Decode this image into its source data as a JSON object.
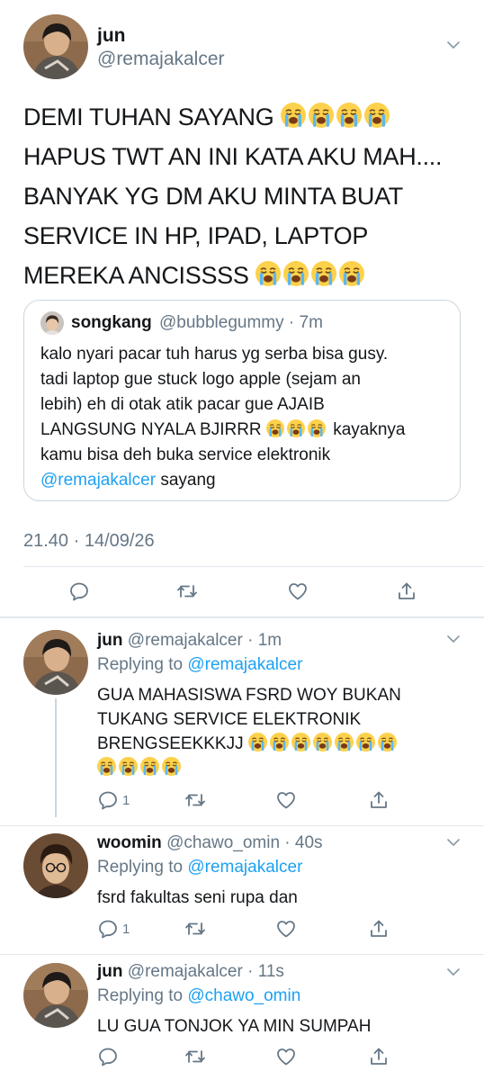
{
  "main_tweet": {
    "display_name": "jun",
    "handle": "@remajakalcer",
    "lines": [
      {
        "text": "DEMI TUHAN SAYANG",
        "emoji_count": 4
      },
      {
        "text": "HAPUS TWT AN INI KATA AKU MAH....",
        "emoji_count": 0
      },
      {
        "text": "BANYAK YG DM AKU MINTA BUAT",
        "emoji_count": 0
      },
      {
        "text": "SERVICE IN HP, IPAD, LAPTOP",
        "emoji_count": 0
      },
      {
        "text": "MEREKA ANCISSSS",
        "emoji_count": 4
      }
    ],
    "timestamp": "21.40 · 14/09/26"
  },
  "quote": {
    "display_name": "songkang",
    "meta": "@bubblegummy · 7m",
    "line1": "kalo nyari pacar tuh harus yg serba bisa gusy.",
    "line2": "tadi laptop gue stuck logo apple (sejam an",
    "line3": "lebih) eh di otak atik pacar gue AJAIB",
    "line4_before": "LANGSUNG NYALA BJIRRR",
    "line4_after": "kayaknya",
    "line5": "kamu bisa deh buka service elektronik",
    "mention": "@remajakalcer",
    "line6_after": " sayang"
  },
  "replies": [
    {
      "display_name": "jun",
      "meta": "@remajakalcer · 1m",
      "replying_prefix": "Replying to ",
      "replying_to": "@remajakalcer",
      "line1": "GUA MAHASISWA FSRD WOY BUKAN",
      "line2": "TUKANG SERVICE ELEKTRONIK",
      "line3": "BRENGSEEKKKJJ",
      "reply_count": "1"
    },
    {
      "display_name": "woomin",
      "meta": "@chawo_omin · 40s",
      "replying_prefix": "Replying to ",
      "replying_to": "@remajakalcer",
      "line1": "fsrd fakultas seni rupa dan",
      "reply_count": "1"
    },
    {
      "display_name": "jun",
      "meta": "@remajakalcer · 11s",
      "replying_prefix": "Replying to ",
      "replying_to": "@chawo_omin",
      "line1": "LU GUA TONJOK YA MIN SUMPAH"
    }
  ],
  "icons": {
    "reply": "reply-icon",
    "retweet": "retweet-icon",
    "like": "like-icon",
    "share": "share-icon",
    "caret": "chevron-down-icon",
    "emoji": "loudly-crying-face-emoji"
  },
  "colors": {
    "link": "#1da1f2",
    "secondary_text": "#657786",
    "divider": "#e1e8ed"
  }
}
